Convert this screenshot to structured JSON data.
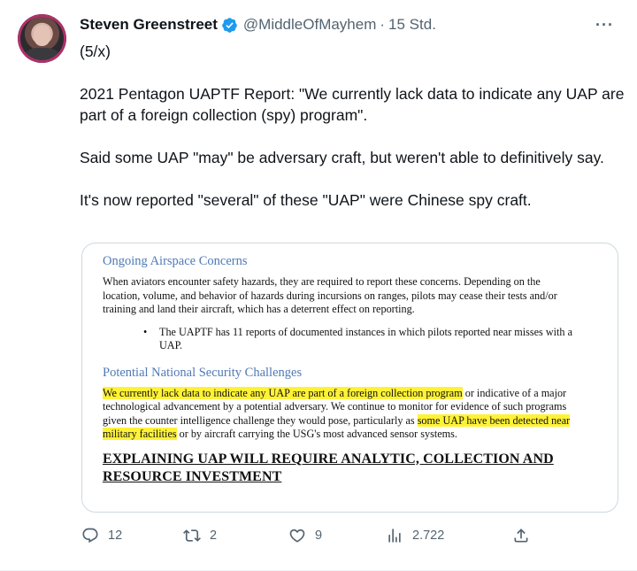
{
  "author": {
    "name": "Steven Greenstreet",
    "handle": "@MiddleOfMayhem",
    "separator": "·",
    "time": "15 Std.",
    "verified_icon": "verified-badge-icon",
    "accent": "#1d9bf0"
  },
  "menu": {
    "more": "···"
  },
  "tweet": {
    "lines": [
      "(5/x)",
      "",
      "2021 Pentagon UAPTF Report: \"We currently lack data to indicate any UAP are part of a foreign collection (spy) program\".",
      "",
      "Said some UAP \"may\" be adversary craft, but weren't able to definitively say.",
      "",
      "It's now reported \"several\" of these \"UAP\" were Chinese spy craft."
    ]
  },
  "document": {
    "heading1": "Ongoing Airspace Concerns",
    "para1": "When aviators encounter safety hazards, they are required to report these concerns.  Depending on the location, volume, and behavior of hazards during incursions on ranges, pilots may cease their tests and/or training and land their aircraft, which has a deterrent effect on reporting.",
    "bullet1": "The UAPTF has 11 reports of documented instances in which pilots reported near misses with a UAP.",
    "heading2": "Potential National Security Challenges",
    "para2_highlight1": "We currently lack data to indicate any UAP are part of a foreign collection program",
    "para2_mid": " or indicative of a major technological advancement by a potential adversary.  We continue to monitor for evidence of such programs given the counter intelligence challenge they would pose, particularly as ",
    "para2_highlight2": "some UAP have been detected near military facilities",
    "para2_end": " or by aircraft carrying the USG's most advanced sensor systems.",
    "big_heading": "EXPLAINING UAP WILL REQUIRE ANALYTIC, COLLECTION AND RESOURCE INVESTMENT"
  },
  "actions": {
    "replies": "12",
    "retweets": "2",
    "likes": "9",
    "views": "2.722"
  }
}
